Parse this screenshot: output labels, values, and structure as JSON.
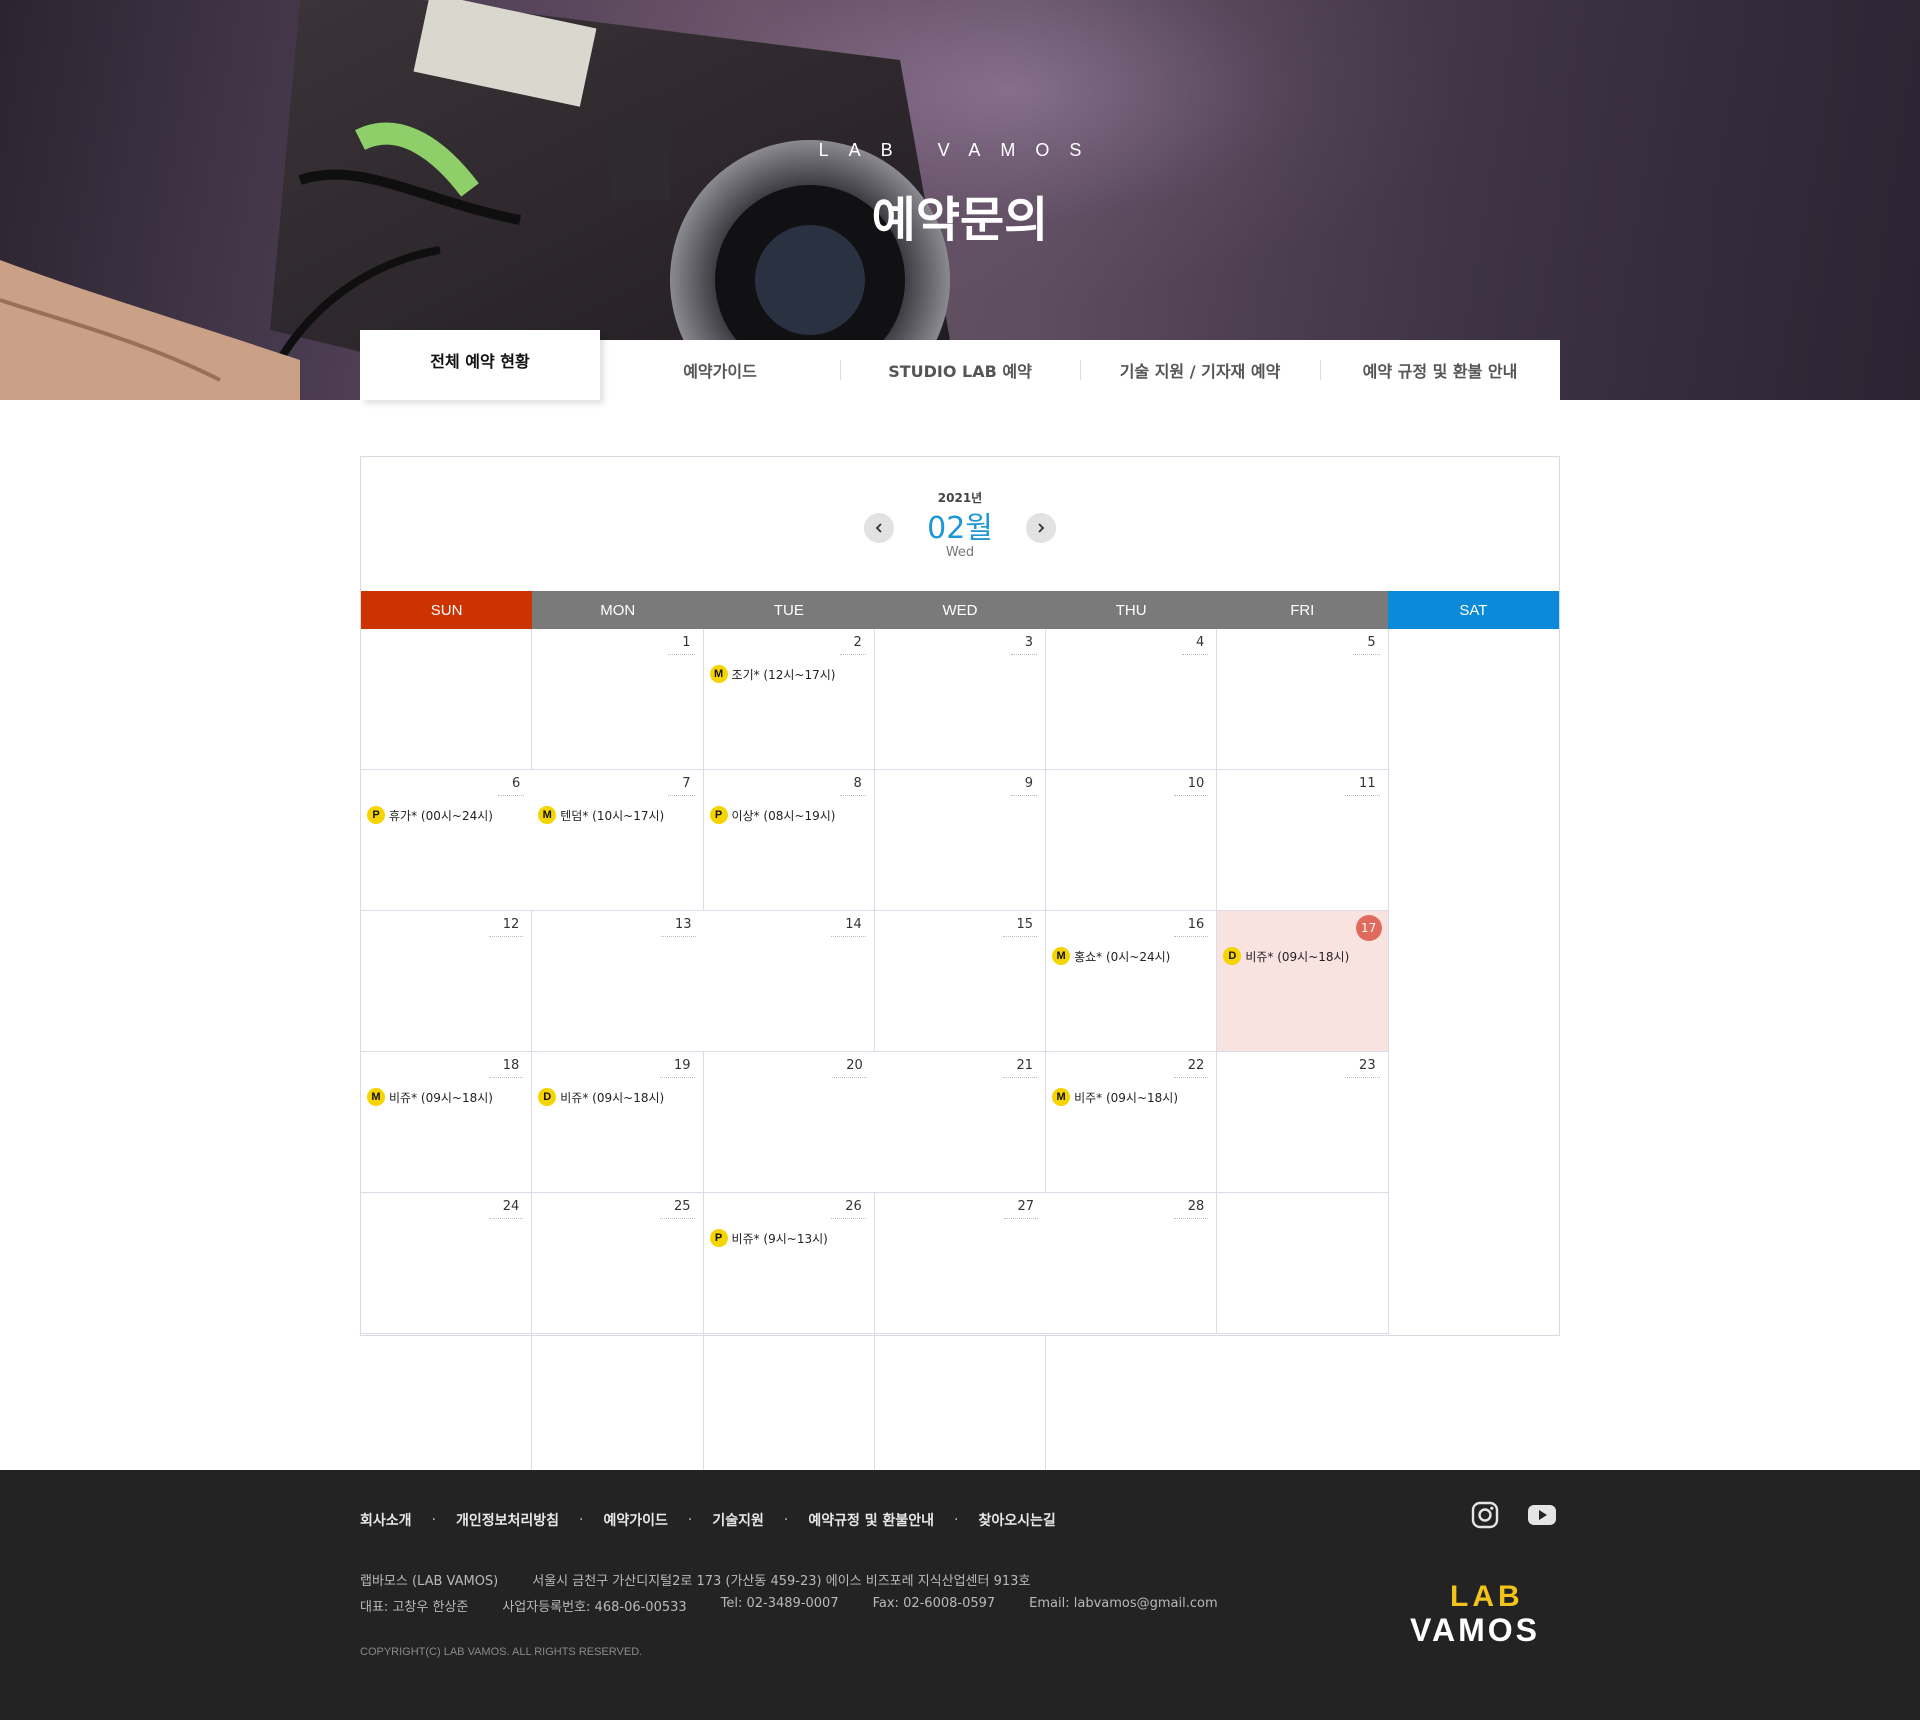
{
  "hero": {
    "brand": "LAB VAMOS",
    "title": "예약문의"
  },
  "tabs": [
    {
      "label": "전체 예약 현황",
      "active": true
    },
    {
      "label": "예약가이드",
      "active": false
    },
    {
      "label": "STUDIO LAB 예약",
      "active": false
    },
    {
      "label": "기술 지원 / 기자재 예약",
      "active": false
    },
    {
      "label": "예약 규정 및 환불 안내",
      "active": false
    }
  ],
  "calendar": {
    "year": "2021년",
    "month": "02월",
    "weekday": "Wed",
    "today": 17,
    "weekdays": [
      "SUN",
      "MON",
      "TUE",
      "WED",
      "THU",
      "FRI",
      "SAT"
    ],
    "first_weekday_index": 1,
    "days_in_month": 28,
    "total_cells": 35,
    "events": [
      {
        "day": 2,
        "badge": "M",
        "text": "조기* (12시~17시)"
      },
      {
        "day": 6,
        "badge": "P",
        "text": "휴가* (00시~24시)"
      },
      {
        "day": 7,
        "badge": "M",
        "text": "텐덤* (10시~17시)"
      },
      {
        "day": 8,
        "badge": "P",
        "text": "이상* (08시~19시)"
      },
      {
        "day": 16,
        "badge": "M",
        "text": "홍쇼* (0시~24시)"
      },
      {
        "day": 17,
        "badge": "D",
        "text": "비쥬* (09시~18시)"
      },
      {
        "day": 18,
        "badge": "M",
        "text": "비쥬* (09시~18시)"
      },
      {
        "day": 19,
        "badge": "D",
        "text": "비쥬* (09시~18시)"
      },
      {
        "day": 22,
        "badge": "M",
        "text": "비주* (09시~18시)"
      },
      {
        "day": 26,
        "badge": "P",
        "text": "비쥬* (9시~13시)"
      }
    ],
    "colors": {
      "sunday": "#cc3300",
      "saturday": "#0b8ad9",
      "weekday": "#7a7a7a",
      "month": "#1f97d4",
      "today_bg": "#f9e3e1",
      "today_circle": "#e26a5c",
      "badge": "#f5d400"
    }
  },
  "footer": {
    "links": [
      "회사소개",
      "개인정보처리방침",
      "예약가이드",
      "기술지원",
      "예약규정 및 환불안내",
      "찾아오시는길"
    ],
    "separator": "·",
    "company": "랩바모스 (LAB VAMOS)",
    "address": "서울시 금천구 가산디지털2로 173 (가산동 459-23) 에이스 비즈포레 지식산업센터 913호",
    "ceo": "대표: 고창우 한상준",
    "business_no": "사업자등록번호: 468-06-00533",
    "tel": "Tel: 02-3489-0007",
    "fax": "Fax: 02-6008-0597",
    "email": "Email:  labvamos@gmail.com",
    "copyright": "COPYRIGHT(C) LAB VAMOS. ALL RIGHTS RESERVED.",
    "social": [
      "instagram-icon",
      "youtube-icon"
    ],
    "logo_top": "LAB",
    "logo_bottom": "VAMOS"
  }
}
